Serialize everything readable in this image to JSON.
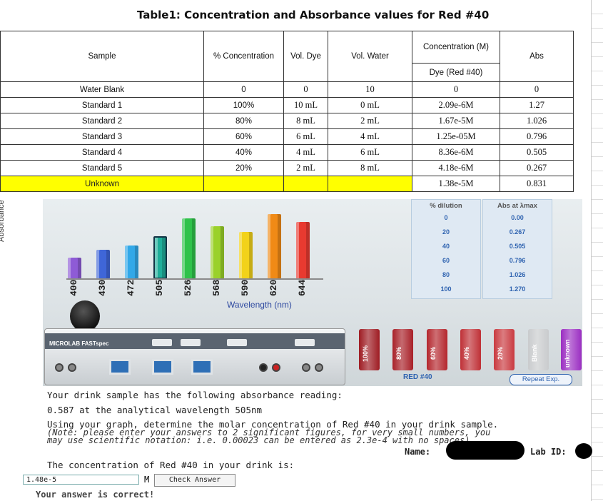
{
  "table": {
    "title": "Table1: Concentration and Absorbance values for Red #40",
    "headers": {
      "sample": "Sample",
      "pct": "% Concentration",
      "vol_dye": "Vol. Dye",
      "vol_water": "Vol. Water",
      "conc": "Concentration (M)",
      "conc_sub": "Dye (Red #40)",
      "abs": "Abs"
    },
    "rows": [
      {
        "sample": "Water Blank",
        "pct": "0",
        "vol_dye": "0",
        "vol_water": "10",
        "conc": "0",
        "abs": "0"
      },
      {
        "sample": "Standard 1",
        "pct": "100%",
        "vol_dye": "10 mL",
        "vol_water": "0 mL",
        "conc": "2.09e-6M",
        "abs": "1.27"
      },
      {
        "sample": "Standard 2",
        "pct": "80%",
        "vol_dye": "8 mL",
        "vol_water": "2 mL",
        "conc": "1.67e-5M",
        "abs": "1.026"
      },
      {
        "sample": "Standard 3",
        "pct": "60%",
        "vol_dye": "6 mL",
        "vol_water": "4 mL",
        "conc": "1.25e-05M",
        "abs": "0.796"
      },
      {
        "sample": "Standard 4",
        "pct": "40%",
        "vol_dye": "4 mL",
        "vol_water": "6 mL",
        "conc": "8.36e-6M",
        "abs": "0.505"
      },
      {
        "sample": "Standard 5",
        "pct": "20%",
        "vol_dye": "2 mL",
        "vol_water": "8 mL",
        "conc": "4.18e-6M",
        "abs": "0.267"
      }
    ],
    "unknown": {
      "sample": "Unknown",
      "conc": "1.38e-5M",
      "abs": "0.831"
    }
  },
  "lab": {
    "absorbance_label": "Absorbance",
    "wavelengths": [
      "400",
      "430",
      "472",
      "505",
      "526",
      "568",
      "590",
      "620",
      "644"
    ],
    "bar_colors": [
      "#8e5bd6",
      "#3f66d8",
      "#32a8e8",
      "#1fae9a",
      "#2fc24a",
      "#9ad12a",
      "#f2d21a",
      "#f08a16",
      "#e83a30"
    ],
    "bar_levels": [
      0.22,
      0.3,
      0.34,
      0.44,
      0.62,
      0.54,
      0.48,
      0.66,
      0.58
    ],
    "selected_index": 3,
    "wavelength_label": "Wavelength (nm)",
    "dilution": {
      "header_left": "% dilution",
      "header_right": "Abs at λmax",
      "dilutions": [
        "0",
        "20",
        "40",
        "60",
        "80",
        "100"
      ],
      "abs": [
        "0.00",
        "0.267",
        "0.505",
        "0.796",
        "1.026",
        "1.270"
      ]
    },
    "device": {
      "logo": "MICROLAB FASTspec"
    },
    "vials": [
      {
        "label": "100%",
        "color": "#9e1b22"
      },
      {
        "label": "80%",
        "color": "#a82028"
      },
      {
        "label": "60%",
        "color": "#b4262d"
      },
      {
        "label": "40%",
        "color": "#bf3036"
      },
      {
        "label": "20%",
        "color": "#c93a40"
      },
      {
        "label": "Blank",
        "color": "#c9cbcd"
      },
      {
        "label": "unknown",
        "color": "#9b2ec2"
      }
    ],
    "red40_label": "RED #40",
    "repeat_label": "Repeat Exp."
  },
  "question": {
    "line1": "Your drink sample has the following absorbance reading:",
    "line2": "0.587 at the analytical wavelength 505nm",
    "line3": "Using your graph, determine the molar concentration of Red #40 in your drink sample.",
    "note1": "(Note: please enter your answers to 2 significant figures, for very small numbers, you",
    "note2": "may use scientific notation: i.e. 0.00023 can be entered as 2.3e-4 with no spaces).",
    "name_label": "Name:",
    "labid_label": "Lab ID:",
    "prompt": "The concentration of Red #40 in your drink is:",
    "answer_value": "1.48e-5",
    "unit": "M",
    "check_label": "Check Answer",
    "result": "Your answer is correct!"
  }
}
